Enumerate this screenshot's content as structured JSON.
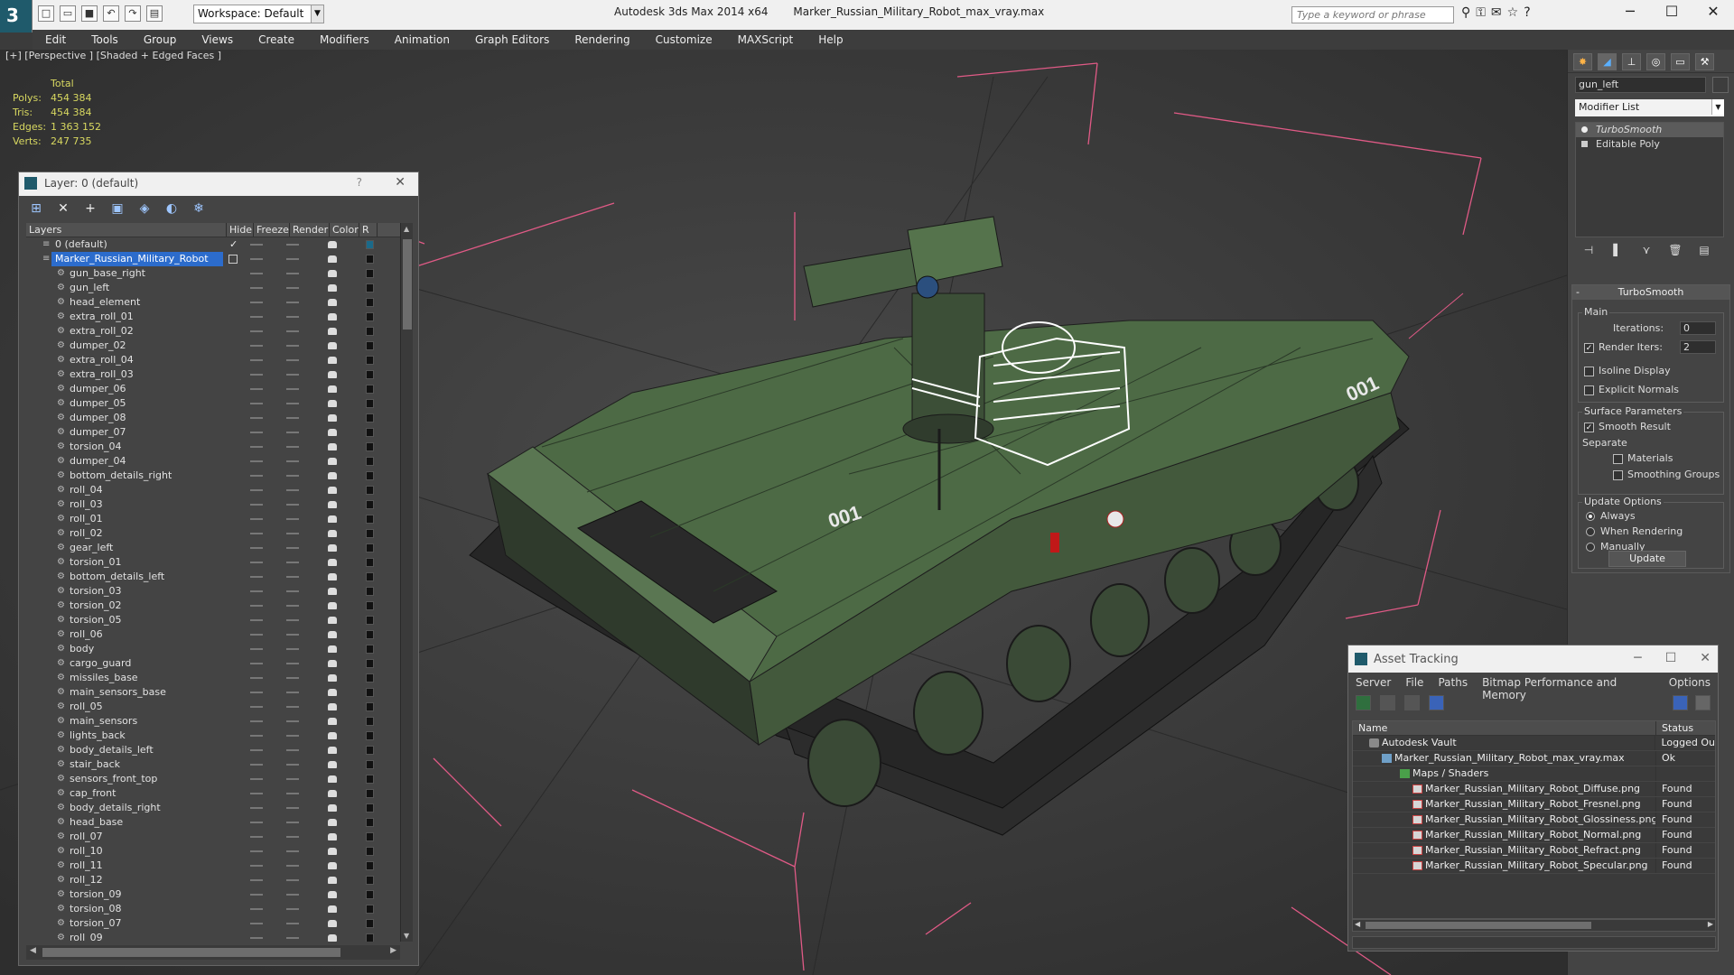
{
  "titlebar": {
    "workspace": "Workspace: Default",
    "app": "Autodesk 3ds Max  2014 x64",
    "file": "Marker_Russian_Military_Robot_max_vray.max",
    "search_placeholder": "Type a keyword or phrase"
  },
  "menu": [
    "Edit",
    "Tools",
    "Group",
    "Views",
    "Create",
    "Modifiers",
    "Animation",
    "Graph Editors",
    "Rendering",
    "Customize",
    "MAXScript",
    "Help"
  ],
  "viewport": {
    "label": "[+] [Perspective ] [Shaded + Edged Faces ]",
    "stats": {
      "total_label": "Total",
      "polys_label": "Polys:",
      "polys": "454 384",
      "tris_label": "Tris:",
      "tris": "454 384",
      "edges_label": "Edges:",
      "edges": "1 363 152",
      "verts_label": "Verts:",
      "verts": "247 735"
    },
    "decals": [
      "001",
      "001"
    ]
  },
  "layer_dialog": {
    "title": "Layer: 0 (default)",
    "help": "?",
    "columns": [
      "Layers",
      "Hide",
      "Freeze",
      "Render",
      "Color",
      "R"
    ],
    "layers": [
      "0 (default)",
      "Marker_Russian_Military_Robot"
    ],
    "objects": [
      "gun_base_right",
      "gun_left",
      "head_element",
      "extra_roll_01",
      "extra_roll_02",
      "dumper_02",
      "extra_roll_04",
      "extra_roll_03",
      "dumper_06",
      "dumper_05",
      "dumper_08",
      "dumper_07",
      "torsion_04",
      "dumper_04",
      "bottom_details_right",
      "roll_04",
      "roll_03",
      "roll_01",
      "roll_02",
      "gear_left",
      "torsion_01",
      "bottom_details_left",
      "torsion_03",
      "torsion_02",
      "torsion_05",
      "roll_06",
      "body",
      "cargo_guard",
      "missiles_base",
      "main_sensors_base",
      "roll_05",
      "main_sensors",
      "lights_back",
      "body_details_left",
      "stair_back",
      "sensors_front_top",
      "cap_front",
      "body_details_right",
      "head_base",
      "roll_07",
      "roll_10",
      "roll_11",
      "roll_12",
      "torsion_09",
      "torsion_08",
      "torsion_07",
      "roll_09"
    ]
  },
  "command_panel": {
    "object_name": "gun_left",
    "modifier_list": "Modifier List",
    "stack": [
      "TurboSmooth",
      "Editable Poly"
    ],
    "turbosmooth": {
      "title": "TurboSmooth",
      "main": "Main",
      "iterations_label": "Iterations:",
      "iterations": "0",
      "render_iters_label": "Render Iters:",
      "render_iters": "2",
      "isoline": "Isoline Display",
      "explicit_normals": "Explicit Normals",
      "surface_params": "Surface Parameters",
      "smooth_result": "Smooth Result",
      "separate": "Separate",
      "materials": "Materials",
      "smoothing_groups": "Smoothing Groups",
      "update_options": "Update Options",
      "always": "Always",
      "when_rendering": "When Rendering",
      "manually": "Manually",
      "update_button": "Update"
    }
  },
  "asset_tracking": {
    "title": "Asset Tracking",
    "menu": [
      "Server",
      "File",
      "Paths",
      "Bitmap Performance and Memory",
      "Options"
    ],
    "columns": [
      "Name",
      "Status"
    ],
    "rows": [
      {
        "name": "Autodesk Vault",
        "status": "Logged Ou",
        "icon": "vault-icon"
      },
      {
        "name": "Marker_Russian_Military_Robot_max_vray.max",
        "status": "Ok",
        "icon": "max-file-icon"
      },
      {
        "name": "Maps / Shaders",
        "status": "",
        "icon": "folder-icon"
      },
      {
        "name": "Marker_Russian_Military_Robot_Diffuse.png",
        "status": "Found",
        "icon": "png-icon"
      },
      {
        "name": "Marker_Russian_Military_Robot_Fresnel.png",
        "status": "Found",
        "icon": "png-icon"
      },
      {
        "name": "Marker_Russian_Military_Robot_Glossiness.png",
        "status": "Found",
        "icon": "png-icon"
      },
      {
        "name": "Marker_Russian_Military_Robot_Normal.png",
        "status": "Found",
        "icon": "png-icon"
      },
      {
        "name": "Marker_Russian_Military_Robot_Refract.png",
        "status": "Found",
        "icon": "png-icon"
      },
      {
        "name": "Marker_Russian_Military_Robot_Specular.png",
        "status": "Found",
        "icon": "png-icon"
      }
    ]
  },
  "colors": {
    "selection": "#2c6ccc",
    "stats_text": "#d8d860",
    "grid_pink": "#e05a86",
    "robot_green": "#4d6a45"
  }
}
